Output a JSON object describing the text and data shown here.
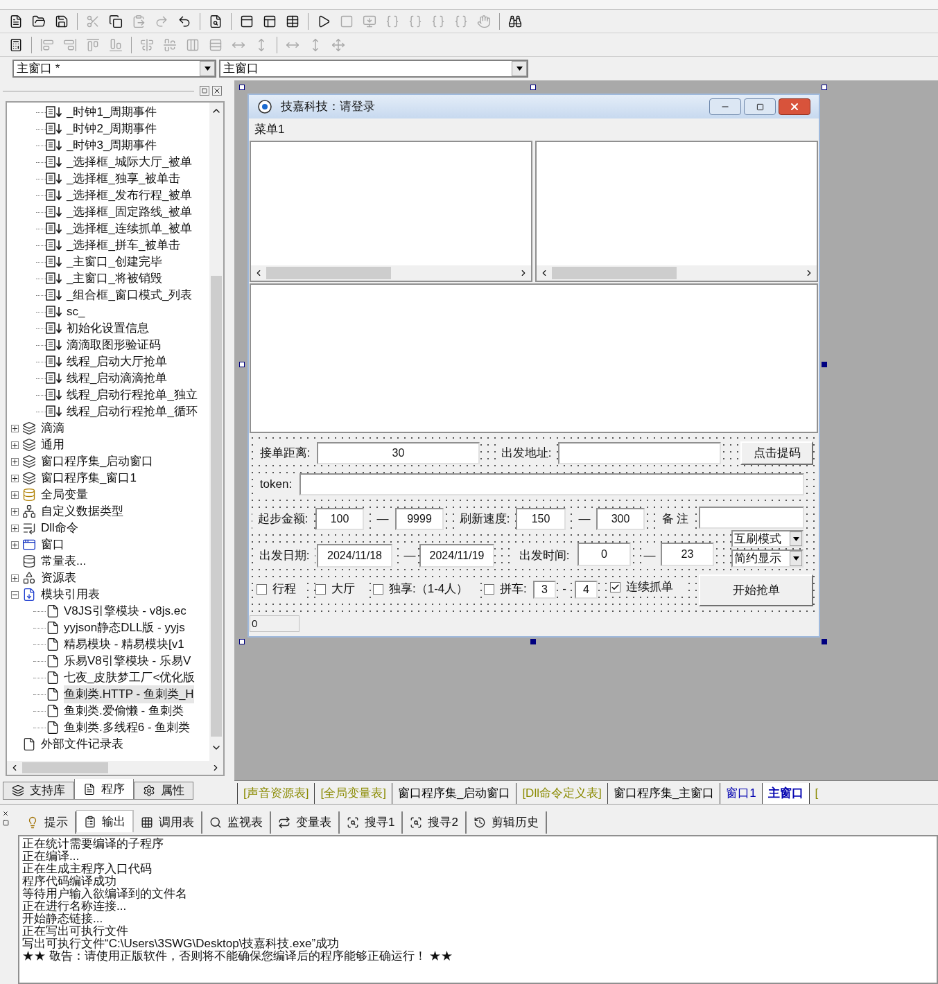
{
  "toolbars": [
    [
      {
        "disabled": false
      },
      {
        "disabled": false
      },
      {
        "disabled": false
      },
      {
        "disabled": true
      },
      {
        "disabled": false
      },
      {
        "disabled": true
      },
      {
        "disabled": true
      },
      {
        "disabled": false
      },
      {
        "disabled": false
      },
      {
        "disabled": false
      },
      {
        "disabled": false
      },
      {
        "disabled": false
      },
      {
        "disabled": false
      },
      {
        "disabled": true
      },
      {
        "disabled": true
      },
      {
        "disabled": true
      },
      {
        "disabled": true
      },
      {
        "disabled": true
      },
      {
        "disabled": true
      },
      {
        "disabled": true
      },
      {
        "disabled": false
      }
    ],
    [
      {
        "disabled": false
      },
      {
        "disabled": true
      },
      {
        "disabled": true
      },
      {
        "disabled": true
      },
      {
        "disabled": true
      },
      {
        "disabled": true
      },
      {
        "disabled": true
      },
      {
        "disabled": true
      },
      {
        "disabled": true
      },
      {
        "disabled": true
      },
      {
        "disabled": true
      },
      {
        "disabled": true
      },
      {
        "disabled": true
      },
      {
        "disabled": true
      }
    ]
  ],
  "object_combo": {
    "value": "主窗口 *"
  },
  "event_combo": {
    "value": "主窗口"
  },
  "tree": {
    "continued_items": [
      "_时钟1_周期事件",
      "_时钟2_周期事件",
      "_时钟3_周期事件",
      "_选择框_城际大厅_被单",
      "_选择框_独享_被单击",
      "_选择框_发布行程_被单",
      "_选择框_固定路线_被单",
      "_选择框_连续抓单_被单",
      "_选择框_拼车_被单击",
      "_主窗口_创建完毕",
      "_主窗口_将被销毁",
      "_组合框_窗口模式_列表",
      "sc_",
      "初始化设置信息",
      "滴滴取图形验证码",
      "线程_启动大厅抢单",
      "线程_启动滴滴抢单",
      "线程_启动行程抢单_独立",
      "线程_启动行程抢单_循环"
    ],
    "items": [
      {
        "label": "滴滴",
        "kind": "lib",
        "expanded": false
      },
      {
        "label": "通用",
        "kind": "lib",
        "expanded": false
      },
      {
        "label": "窗口程序集_启动窗口",
        "kind": "lib",
        "expanded": false
      },
      {
        "label": "窗口程序集_窗口1",
        "kind": "lib",
        "expanded": false
      },
      {
        "label": "全局变量",
        "kind": "var",
        "expanded": false
      },
      {
        "label": "自定义数据类型",
        "kind": "type",
        "expanded": false
      },
      {
        "label": "Dll命令",
        "kind": "dll",
        "expanded": false
      },
      {
        "label": "窗口",
        "kind": "window",
        "expanded": false
      },
      {
        "label": "常量表...",
        "kind": "const"
      },
      {
        "label": "资源表",
        "kind": "resource",
        "expanded": false
      },
      {
        "label": "模块引用表",
        "kind": "module",
        "expanded": true,
        "children": [
          {
            "label": "V8JS引擎模块 - v8js.ec",
            "selected": false
          },
          {
            "label": "yyjson静态DLL版 - yyjs",
            "selected": false
          },
          {
            "label": "精易模块 - 精易模块[v1",
            "selected": false
          },
          {
            "label": "乐易V8引擎模块 - 乐易V",
            "selected": false
          },
          {
            "label": "七夜_皮肤梦工厂<优化版",
            "selected": false
          },
          {
            "label": "鱼刺类.HTTP - 鱼刺类_H",
            "selected": true
          },
          {
            "label": "鱼刺类.爱偷懒 - 鱼刺类",
            "selected": false
          },
          {
            "label": "鱼刺类.多线程6 - 鱼刺类",
            "selected": false
          }
        ]
      },
      {
        "label": "外部文件记录表",
        "kind": "file"
      }
    ]
  },
  "panel_tabs": [
    {
      "label": "支持库",
      "selected": false
    },
    {
      "label": "程序",
      "selected": true
    },
    {
      "label": "属性",
      "selected": false
    }
  ],
  "form": {
    "title": "技嘉科技：请登录",
    "menu": "菜单1",
    "status": "0",
    "controls": [
      {
        "kind": "label",
        "text": "接单距离:"
      },
      {
        "kind": "input",
        "value": "30"
      },
      {
        "kind": "label",
        "text": "出发地址:"
      },
      {
        "kind": "input"
      },
      {
        "kind": "button",
        "text": "点击提码"
      },
      {
        "kind": "label",
        "text": "token:"
      },
      {
        "kind": "input"
      },
      {
        "kind": "label",
        "text": "起步金额:"
      },
      {
        "kind": "input",
        "value": "100"
      },
      {
        "kind": "label",
        "text": "—"
      },
      {
        "kind": "input",
        "value": "9999"
      },
      {
        "kind": "label",
        "text": "刷新速度:"
      },
      {
        "kind": "input",
        "value": "150"
      },
      {
        "kind": "label",
        "text": "—"
      },
      {
        "kind": "input",
        "value": "300"
      },
      {
        "kind": "label",
        "text": "备 注"
      },
      {
        "kind": "input"
      },
      {
        "kind": "combo",
        "value": "互刷模式"
      },
      {
        "kind": "label",
        "text": "出发日期:"
      },
      {
        "kind": "input",
        "value": "2024/11/18"
      },
      {
        "kind": "label",
        "text": "—"
      },
      {
        "kind": "input",
        "value": "2024/11/19"
      },
      {
        "kind": "label",
        "text": "出发时间:"
      },
      {
        "kind": "input",
        "value": "0"
      },
      {
        "kind": "label",
        "text": "—"
      },
      {
        "kind": "input",
        "value": "23"
      },
      {
        "kind": "combo",
        "value": "简约显示"
      },
      {
        "kind": "checkbox",
        "text": "行程",
        "checked": false
      },
      {
        "kind": "checkbox",
        "text": "大厅",
        "checked": false
      },
      {
        "kind": "checkbox",
        "text": "独享:（1-4人）",
        "checked": false
      },
      {
        "kind": "checkbox",
        "text": "拼车:",
        "checked": false
      },
      {
        "kind": "input",
        "value": "3"
      },
      {
        "kind": "label",
        "text": "-"
      },
      {
        "kind": "input",
        "value": "4"
      },
      {
        "kind": "checkbox",
        "text": "连续抓单",
        "checked": true
      },
      {
        "kind": "button",
        "text": "开始抢单"
      }
    ]
  },
  "doc_tabs": [
    {
      "label": "[声音资源表]",
      "kind": "table",
      "selected": false
    },
    {
      "label": "[全局变量表]",
      "kind": "table",
      "selected": false
    },
    {
      "label": "窗口程序集_启动窗口",
      "kind": "code",
      "selected": false
    },
    {
      "label": "[Dll命令定义表]",
      "kind": "table",
      "selected": false
    },
    {
      "label": "窗口程序集_主窗口",
      "kind": "code",
      "selected": false
    },
    {
      "label": "窗口1",
      "kind": "form",
      "selected": false
    },
    {
      "label": "主窗口",
      "kind": "form",
      "selected": true
    },
    {
      "label": "[",
      "kind": "table",
      "selected": false
    }
  ],
  "bottom_tabs": [
    {
      "label": "提示",
      "selected": false
    },
    {
      "label": "输出",
      "selected": true
    },
    {
      "label": "调用表",
      "selected": false
    },
    {
      "label": "监视表",
      "selected": false
    },
    {
      "label": "变量表",
      "selected": false
    },
    {
      "label": "搜寻1",
      "selected": false
    },
    {
      "label": "搜寻2",
      "selected": false
    },
    {
      "label": "剪辑历史",
      "selected": false
    }
  ],
  "output_lines": [
    "正在统计需要编译的子程序",
    "正在编译...",
    "正在生成主程序入口代码",
    "程序代码编译成功",
    "等待用户输入欲编译到的文件名",
    "正在进行名称连接...",
    "开始静态链接...",
    "正在写出可执行文件",
    "写出可执行文件“C:\\Users\\3SWG\\Desktop\\技嘉科技.exe”成功",
    "★★ 敬告：请使用正版软件，否则将不能确保您编译后的程序能够正确运行！ ★★"
  ]
}
